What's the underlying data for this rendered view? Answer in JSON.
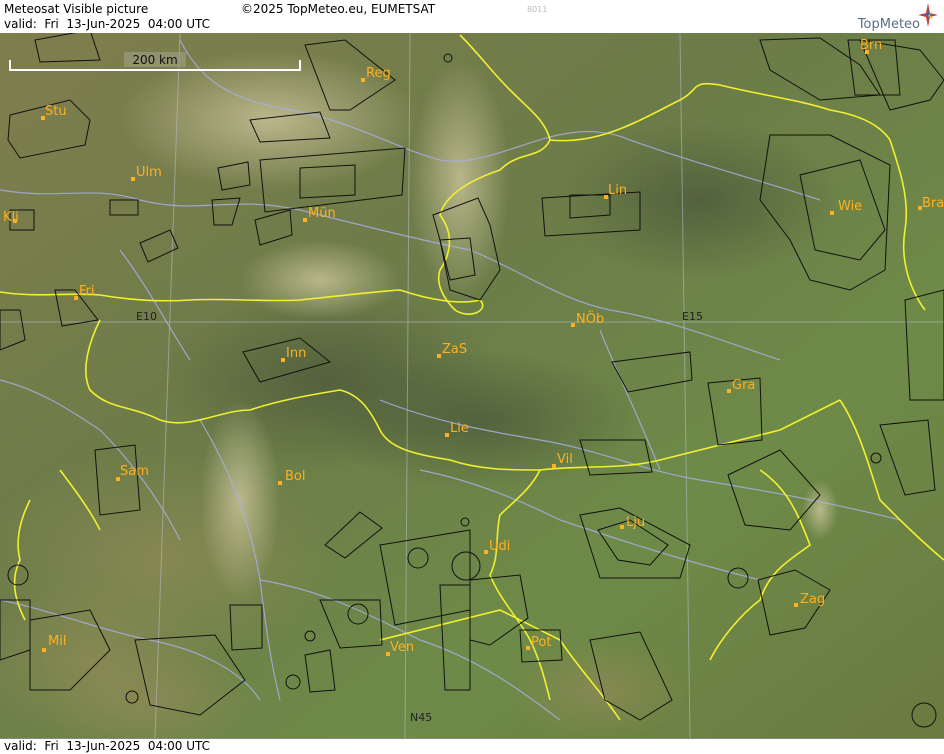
{
  "header": {
    "title": "Meteosat Visible picture",
    "valid": "valid:  Fri  13-Jun-2025  04:00 UTC",
    "copyright": "©2025 TopMeteo.eu, EUMETSAT",
    "image_id": "8011",
    "logo": "TopMeteo"
  },
  "footer": {
    "valid": "valid:  Fri  13-Jun-2025  04:00 UTC"
  },
  "scale": {
    "label": "200 km"
  },
  "grid_labels": [
    "E10",
    "E15",
    "N45"
  ],
  "cities": [
    "Reg",
    "Brn",
    "Stu",
    "Ulm",
    "Lin",
    "Wie",
    "Bra",
    "Kli",
    "Mün",
    "Fri",
    "NÖb",
    "ZaS",
    "Inn",
    "Gra",
    "Lie",
    "Vil",
    "Sam",
    "Bol",
    "Lju",
    "Udi",
    "Zag",
    "Mil",
    "Ven",
    "Pot"
  ],
  "colors": {
    "border": "#f0f030",
    "river": "#a8aee0",
    "airspace": "#111111",
    "city": "#ffb020"
  },
  "icons": {
    "logo_star": "compass-star-icon"
  }
}
